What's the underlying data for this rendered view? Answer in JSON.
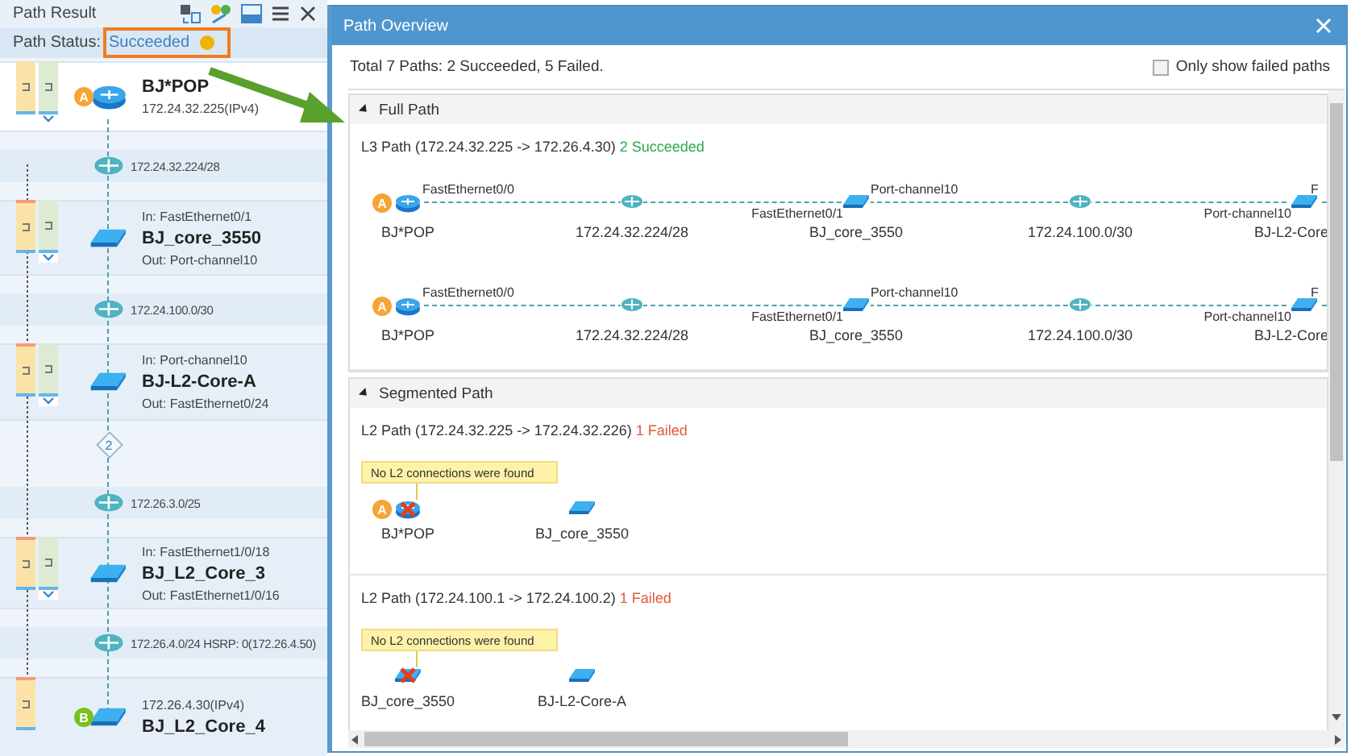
{
  "left_panel": {
    "title": "Path Result",
    "status_label": "Path Status:",
    "status_value": "Succeeded",
    "hops": [
      {
        "kind": "router",
        "badge": "A",
        "selected": true,
        "l2_tag": true,
        "expander": true,
        "name": "BJ*POP",
        "below": "172.24.32.225(IPv4)"
      },
      {
        "kind": "network",
        "label": "172.24.32.224/28"
      },
      {
        "kind": "switch",
        "selected": false,
        "l2_tag": true,
        "expander": true,
        "above": "In: FastEthernet0/1",
        "name": "BJ_core_3550",
        "below": "Out: Port-channel10"
      },
      {
        "kind": "network",
        "label": "172.24.100.0/30"
      },
      {
        "kind": "switch",
        "selected": false,
        "l2_tag": true,
        "expander": true,
        "above": "In: Port-channel10",
        "name": "BJ-L2-Core-A",
        "below": "Out: FastEthernet0/24"
      },
      {
        "kind": "hop_count",
        "label": "2"
      },
      {
        "kind": "network",
        "label": "172.26.3.0/25"
      },
      {
        "kind": "switch",
        "selected": false,
        "l2_tag": true,
        "expander": true,
        "above": "In: FastEthernet1/0/18",
        "name": "BJ_L2_Core_3",
        "below": "Out: FastEthernet1/0/16"
      },
      {
        "kind": "network",
        "label": "172.26.4.0/24 HSRP: 0(172.26.4.50)"
      },
      {
        "kind": "switch",
        "badge": "B",
        "selected": false,
        "l2_tag": false,
        "above": "172.26.4.30(IPv4)",
        "name": "BJ_L2_Core_4"
      }
    ]
  },
  "dialog": {
    "title": "Path Overview",
    "summary": "Total 7 Paths: 2 Succeeded, 5 Failed.",
    "filter": {
      "label": "Only show failed paths",
      "checked": false
    },
    "sections": [
      {
        "title": "Full Path",
        "expanded": true,
        "paths": [
          {
            "kind": "l3",
            "title": "L3 Path (172.24.32.225 -> 172.26.4.30)",
            "result": "2 Succeeded",
            "failed": false,
            "routes": [
              [
                {
                  "kind": "router",
                  "badge": "A",
                  "name": "BJ*POP",
                  "out": "FastEthernet0/0"
                },
                {
                  "kind": "network",
                  "name": "172.24.32.224/28"
                },
                {
                  "kind": "switch",
                  "name": "BJ_core_3550",
                  "in": "FastEthernet0/1",
                  "out": "Port-channel10"
                },
                {
                  "kind": "network",
                  "name": "172.24.100.0/30"
                },
                {
                  "kind": "switch",
                  "name": "BJ-L2-Core",
                  "in": "Port-channel10",
                  "out": "F"
                }
              ],
              [
                {
                  "kind": "router",
                  "badge": "A",
                  "name": "BJ*POP",
                  "out": "FastEthernet0/0"
                },
                {
                  "kind": "network",
                  "name": "172.24.32.224/28"
                },
                {
                  "kind": "switch",
                  "name": "BJ_core_3550",
                  "in": "FastEthernet0/1",
                  "out": "Port-channel10"
                },
                {
                  "kind": "network",
                  "name": "172.24.100.0/30"
                },
                {
                  "kind": "switch",
                  "name": "BJ-L2-Core",
                  "in": "Port-channel10",
                  "out": "F"
                }
              ]
            ]
          }
        ]
      },
      {
        "title": "Segmented Path",
        "expanded": true,
        "paths": [
          {
            "kind": "l2",
            "title": "L2 Path (172.24.32.225 -> 172.24.32.226)",
            "result": "1 Failed",
            "failed": true,
            "note": "No L2 connections were found",
            "routes": [
              [
                {
                  "kind": "router",
                  "badge": "A",
                  "name": "BJ*POP",
                  "failed": true
                },
                {
                  "kind": "switch",
                  "name": "BJ_core_3550",
                  "failed": false
                }
              ]
            ]
          },
          {
            "kind": "l2",
            "title": "L2 Path (172.24.100.1 -> 172.24.100.2)",
            "result": "1 Failed",
            "failed": true,
            "note": "No L2 connections were found",
            "routes": [
              [
                {
                  "kind": "switch",
                  "name": "BJ_core_3550",
                  "failed": true
                },
                {
                  "kind": "switch",
                  "name": "BJ-L2-Core-A",
                  "failed": false
                }
              ]
            ]
          }
        ]
      }
    ]
  }
}
